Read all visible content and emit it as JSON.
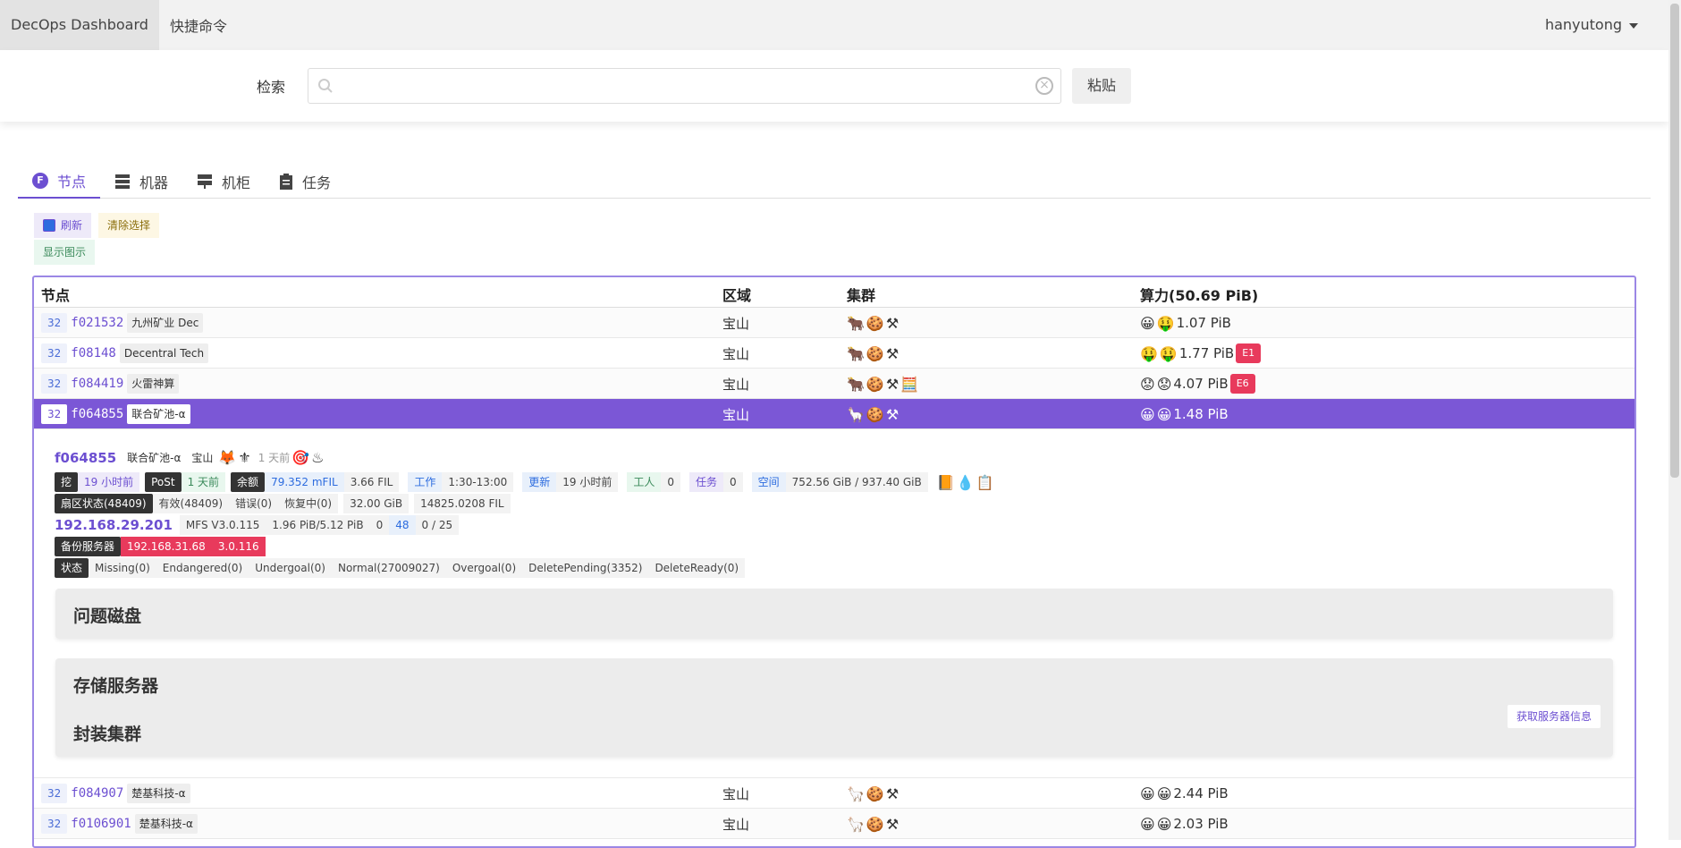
{
  "nav": {
    "brand": "DecOps Dashboard",
    "quick": "快捷命令",
    "user": "hanyutong"
  },
  "search": {
    "label": "检索",
    "placeholder": "",
    "paste": "粘贴"
  },
  "tabs": [
    {
      "label": "节点"
    },
    {
      "label": "机器"
    },
    {
      "label": "机柜"
    },
    {
      "label": "任务"
    }
  ],
  "buttons": {
    "refresh": "刷新",
    "clear": "清除选择",
    "show_chart": "显示图示"
  },
  "table": {
    "headers": {
      "node": "节点",
      "region": "区域",
      "cluster": "集群",
      "power": "算力(50.69 PiB)"
    },
    "rows": [
      {
        "size": "32",
        "id": "f021532",
        "tag": "九州矿业 Dec",
        "region": "宝山",
        "power": "1.07 PiB",
        "badge": ""
      },
      {
        "size": "32",
        "id": "f08148",
        "tag": "Decentral Tech",
        "region": "宝山",
        "power": "1.77 PiB",
        "badge": "E1"
      },
      {
        "size": "32",
        "id": "f084419",
        "tag": "火雷神算",
        "region": "宝山",
        "power": "4.07 PiB",
        "badge": "E6"
      },
      {
        "size": "32",
        "id": "f064855",
        "tag": "联合矿池-α",
        "region": "宝山",
        "power": "1.48 PiB",
        "badge": ""
      }
    ],
    "rows_after": [
      {
        "size": "32",
        "id": "f084907",
        "tag": "楚基科技-α",
        "region": "宝山",
        "power": "2.44 PiB"
      },
      {
        "size": "32",
        "id": "f0106901",
        "tag": "楚基科技-α",
        "region": "宝山",
        "power": "2.03 PiB"
      }
    ]
  },
  "detail": {
    "id": "f064855",
    "pool": "联合矿池-α",
    "region": "宝山",
    "ago": "1 天前",
    "mine_label": "挖",
    "mine_val": "19 小时前",
    "post_label": "PoSt",
    "post_val": "1 天前",
    "bal_label": "余额",
    "bal_val1": "79.352 mFIL",
    "bal_val2": "3.66 FIL",
    "work_label": "工作",
    "work_val": "1:30-13:00",
    "update_label": "更新",
    "update_val": "19 小时前",
    "worker_label": "工人",
    "worker_val": "0",
    "task_label": "任务",
    "task_val": "0",
    "space_label": "空间",
    "space_val": "752.56 GiB / 937.40 GiB",
    "sector_label": "扇区状态(48409)",
    "valid": "有效(48409)",
    "err": "错误(0)",
    "recover": "恢复中(0)",
    "size": "32.00 GiB",
    "fil": "14825.0208 FIL",
    "ip": "192.168.29.201",
    "mfs": "MFS V3.0.115",
    "cap": "1.96 PiB/5.12 PiB",
    "z": "0",
    "n48": "48",
    "frac": "0 / 25",
    "backup_label": "备份服务器",
    "backup_ip": "192.168.31.68",
    "backup_ver": "3.0.116",
    "state_label": "状态",
    "missing": "Missing(0)",
    "endangered": "Endangered(0)",
    "undergoal": "Undergoal(0)",
    "normal": "Normal(27009027)",
    "overgoal": "Overgoal(0)",
    "delpend": "DeletePending(3352)",
    "delready": "DeleteReady(0)",
    "panel_disk": "问题磁盘",
    "panel_storage": "存储服务器",
    "panel_seal": "封装集群",
    "fetch": "获取服务器信息"
  }
}
